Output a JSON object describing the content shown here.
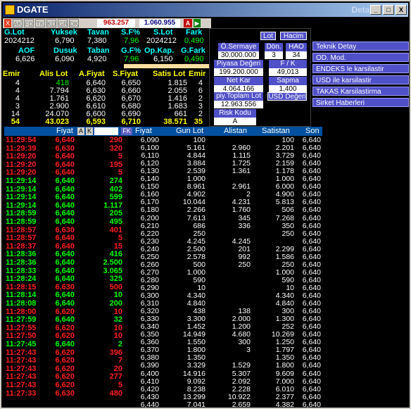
{
  "window": {
    "title": "DGATE",
    "right_title": "Detay",
    "min_label": "_",
    "max_label": "□",
    "close_label": "X"
  },
  "toolbar": {
    "close_label": "X",
    "tabs": [
      "AK",
      "FD",
      "TK",
      "KD",
      "GR",
      "DK"
    ],
    "value1": "963.257",
    "value2": "1.060.955",
    "a_label": "A",
    "arrow_label": "▶"
  },
  "summary1": {
    "headers": [
      "G.Lot",
      "Yuksek",
      "Tavan",
      "S.F%",
      "S.Lot",
      "Fark"
    ],
    "values": [
      "2024212",
      "6,790",
      "7,380",
      "7,96",
      "2024212",
      "0,490"
    ]
  },
  "summary2": {
    "headers": [
      "AOF",
      "Dusuk",
      "Taban",
      "G.F%",
      "Op.Kap.",
      "G.Fark"
    ],
    "values": [
      "6,626",
      "6,090",
      "4,920",
      "7,96",
      "6,150",
      "0,490"
    ]
  },
  "depth_head": {
    "headers": [
      "Emir",
      "Alis Lot",
      "A.Fiyat",
      "S.Fiyat",
      "Satis Lot",
      "Emir"
    ]
  },
  "depth_rows": [
    [
      "4",
      "418",
      "6,640",
      "6,650",
      "1.815",
      "4"
    ],
    [
      "4",
      "7.794",
      "6,630",
      "6,660",
      "2.055",
      "6"
    ],
    [
      "4",
      "1.761",
      "6,620",
      "6,670",
      "1.416",
      "2"
    ],
    [
      "3",
      "2.900",
      "6,610",
      "6,680",
      "1.683",
      "3"
    ],
    [
      "14",
      "24.070",
      "6,600",
      "6,690",
      "661",
      "2"
    ]
  ],
  "depth_total": [
    "54",
    "43.023",
    "6,593",
    "6,710",
    "38.571",
    "35"
  ],
  "info_panel": {
    "lot_label": "Lot",
    "hacim_label": "Hacim",
    "sermaye_label": "Ö.Sermaye",
    "sermaye_value": "30.000.000",
    "don_label": "Dön.",
    "don_value": "3",
    "hao_label": "HAO",
    "hao_value": "34",
    "piyasa_label": "Piyasa Değeri",
    "piyasa_value": "199.200.000",
    "fk_label": "F / K",
    "fk_value": "49,013",
    "netkar_label": "Net Kar",
    "netkar_value": "4.064.166",
    "sapma_label": "Sapma",
    "sapma_value": "1,400",
    "toplam_label": "piy.Toplam Lot",
    "toplam_value": "12.963.556",
    "usd_label": "USD Değeri",
    "risk_label": "Risk Kodu",
    "risk_value": "A"
  },
  "menu": [
    "Teknik Detay",
    "OD. Mod.",
    "ENDEKS le karsilastir",
    "USD ile karsilastir",
    "TAKAS Karsilastirma",
    "Sirket Haberleri"
  ],
  "trades_head": {
    "fiyat": "Fiyat",
    "a_label": "A",
    "k_label": "K",
    "fk_label": "FK"
  },
  "trades": [
    [
      "11:29:54",
      "6,640",
      "290",
      "r"
    ],
    [
      "11:29:39",
      "6,630",
      "320",
      "r"
    ],
    [
      "11:29:20",
      "6,640",
      "5",
      "r"
    ],
    [
      "11:29:20",
      "6,640",
      "195",
      "r"
    ],
    [
      "11:29:20",
      "6,640",
      "5",
      "r"
    ],
    [
      "11:29:14",
      "6,640",
      "274",
      "g"
    ],
    [
      "11:29:14",
      "6,640",
      "402",
      "g"
    ],
    [
      "11:29:14",
      "6,640",
      "599",
      "g"
    ],
    [
      "11:29:14",
      "6,640",
      "1.117",
      "g"
    ],
    [
      "11:28:59",
      "6,640",
      "205",
      "g"
    ],
    [
      "11:28:59",
      "6,640",
      "495",
      "g"
    ],
    [
      "11:28:57",
      "6,630",
      "401",
      "r"
    ],
    [
      "11:28:57",
      "6,640",
      "5",
      "r"
    ],
    [
      "11:28:37",
      "6,640",
      "15",
      "r"
    ],
    [
      "11:28:36",
      "6,640",
      "416",
      "g"
    ],
    [
      "11:28:36",
      "6,640",
      "2.500",
      "g"
    ],
    [
      "11:28:33",
      "6,640",
      "3.065",
      "g"
    ],
    [
      "11:28:24",
      "6,640",
      "325",
      "g"
    ],
    [
      "11:28:15",
      "6,630",
      "500",
      "r"
    ],
    [
      "11:28:14",
      "6,640",
      "10",
      "g"
    ],
    [
      "11:28:08",
      "6,640",
      "200",
      "g"
    ],
    [
      "11:28:00",
      "6,620",
      "10",
      "r"
    ],
    [
      "11:27:59",
      "6,640",
      "32",
      "g"
    ],
    [
      "11:27:55",
      "6,620",
      "10",
      "r"
    ],
    [
      "11:27:50",
      "6,620",
      "10",
      "r"
    ],
    [
      "11:27:45",
      "6,640",
      "2",
      "g"
    ],
    [
      "11:27:43",
      "6,620",
      "396",
      "r"
    ],
    [
      "11:27:43",
      "6,620",
      "7",
      "r"
    ],
    [
      "11:27:43",
      "6,620",
      "20",
      "r"
    ],
    [
      "11:27:43",
      "6,620",
      "277",
      "r"
    ],
    [
      "11:27:43",
      "6,620",
      "5",
      "r"
    ],
    [
      "11:27:33",
      "6,630",
      "480",
      "r"
    ]
  ],
  "price_head": {
    "fiyat": "Fiyat",
    "gun_lot": "Gun Lot",
    "alistan": "Alistan",
    "satistan": "Satistan",
    "son": "Son"
  },
  "price_rows": [
    [
      "6,090",
      "100",
      "",
      "100",
      "6,640"
    ],
    [
      "6,100",
      "5.161",
      "2.960",
      "2.201",
      "6,640"
    ],
    [
      "6,110",
      "4.844",
      "1.115",
      "3.729",
      "6,640"
    ],
    [
      "6,120",
      "3.884",
      "1.725",
      "2.159",
      "6,640"
    ],
    [
      "6,130",
      "2.539",
      "1.361",
      "1.178",
      "6,640"
    ],
    [
      "6,140",
      "1.000",
      "",
      "1.000",
      "6,640"
    ],
    [
      "6,150",
      "8.961",
      "2.961",
      "6.000",
      "6,640"
    ],
    [
      "6,160",
      "4.902",
      "2",
      "4.900",
      "6,640"
    ],
    [
      "6,170",
      "10.044",
      "4.231",
      "5.813",
      "6,640"
    ],
    [
      "6,180",
      "2.266",
      "1.760",
      "506",
      "6,640"
    ],
    [
      "6,200",
      "7.613",
      "345",
      "7.268",
      "6,640"
    ],
    [
      "6,210",
      "686",
      "336",
      "350",
      "6,640"
    ],
    [
      "6,220",
      "250",
      "",
      "250",
      "6,640"
    ],
    [
      "6,230",
      "4.245",
      "4.245",
      "",
      "6,640"
    ],
    [
      "6,240",
      "2.500",
      "201",
      "2.299",
      "6,640"
    ],
    [
      "6,250",
      "2.578",
      "992",
      "1.586",
      "6,640"
    ],
    [
      "6,260",
      "500",
      "250",
      "250",
      "6,640"
    ],
    [
      "6,270",
      "1.000",
      "",
      "1.000",
      "6,640"
    ],
    [
      "6,280",
      "590",
      "",
      "590",
      "6,640"
    ],
    [
      "6,290",
      "10",
      "",
      "10",
      "6,640"
    ],
    [
      "6,300",
      "4.340",
      "",
      "4.340",
      "6,640"
    ],
    [
      "6,310",
      "4.840",
      "",
      "4.840",
      "6,640"
    ],
    [
      "6,320",
      "438",
      "138",
      "300",
      "6,640"
    ],
    [
      "6,330",
      "3.300",
      "2.000",
      "1.300",
      "6,640"
    ],
    [
      "6,340",
      "1.452",
      "1.200",
      "252",
      "6,640"
    ],
    [
      "6,350",
      "14.949",
      "4.680",
      "10.269",
      "6,640"
    ],
    [
      "6,360",
      "1.550",
      "300",
      "1.250",
      "6,640"
    ],
    [
      "6,370",
      "1.800",
      "3",
      "1.797",
      "6,640"
    ],
    [
      "6,380",
      "1.350",
      "",
      "1.350",
      "6,640"
    ],
    [
      "6,390",
      "3.329",
      "1.529",
      "1.800",
      "6,640"
    ],
    [
      "6,400",
      "14.916",
      "5.307",
      "9.609",
      "6,640"
    ],
    [
      "6,410",
      "9.092",
      "2.092",
      "7.000",
      "6,640"
    ],
    [
      "6,420",
      "8.238",
      "2.228",
      "6.010",
      "6,640"
    ],
    [
      "6,430",
      "13.299",
      "10.922",
      "2.377",
      "6,640"
    ],
    [
      "6,440",
      "7.041",
      "2.659",
      "4.382",
      "6,640"
    ]
  ]
}
